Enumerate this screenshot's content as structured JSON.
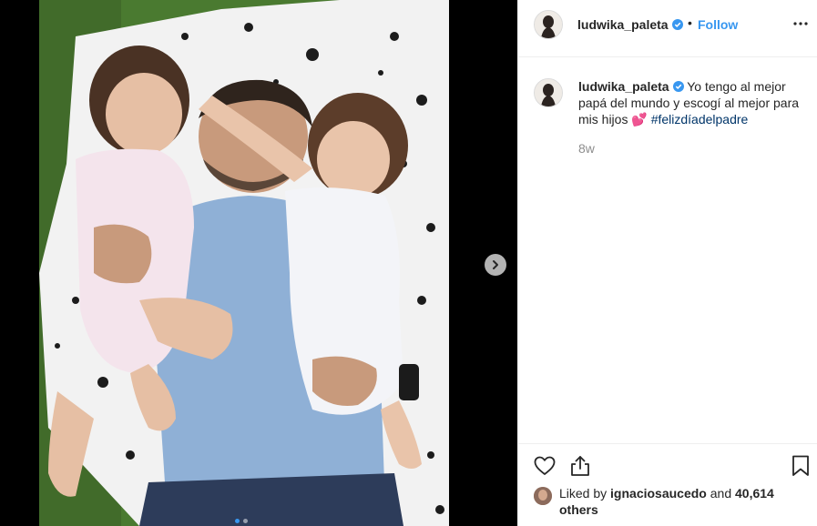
{
  "post": {
    "username": "ludwika_paleta",
    "follow_label": "Follow",
    "bullet": "•",
    "caption": {
      "username": "ludwika_paleta",
      "text": "Yo tengo al mejor papá del mundo y escogí al mejor para mis hijos",
      "emoji": "💕",
      "hashtag": "#felizdíadelpadre",
      "time": "8w"
    },
    "likes": {
      "prefix": "Liked by",
      "liker": "ignaciosaucedo",
      "connector": "and",
      "count_text": "40,614 others"
    }
  },
  "carousel": {
    "slide_count": 2,
    "active_slide": 1
  },
  "colors": {
    "accent": "#3897f0",
    "hashtag": "#003569",
    "secondary_text": "#8e8e8e",
    "primary_text": "#262626"
  },
  "icons": {
    "verified": "verified-badge-icon",
    "more": "more-options-icon",
    "like": "heart-icon",
    "share": "share-icon",
    "save": "bookmark-icon",
    "next": "chevron-right-icon"
  }
}
